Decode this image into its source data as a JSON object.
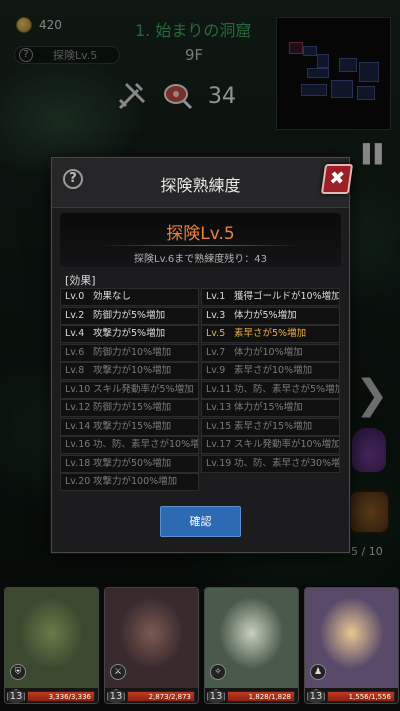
{
  "hud": {
    "gold": "420",
    "explore_badge": "探険Lv.5",
    "floor_name": "1. 始まりの洞窟",
    "floor_number": "9F",
    "meat_count": "34",
    "page_count": "5 / 10"
  },
  "dialog": {
    "title": "探険熟練度",
    "help_glyph": "?",
    "close_glyph": "✖",
    "level_title": "探険Lv.5",
    "level_subtitle": "探険Lv.6まで熟練度残り：43",
    "effects_label": "[効果]",
    "confirm_label": "確認",
    "current_level": 5,
    "effects": [
      {
        "lv": "Lv.0",
        "text": "効果なし"
      },
      {
        "lv": "Lv.1",
        "text": "獲得ゴールドが10%増加"
      },
      {
        "lv": "Lv.2",
        "text": "防御力が5%増加"
      },
      {
        "lv": "Lv.3",
        "text": "体力が5%増加"
      },
      {
        "lv": "Lv.4",
        "text": "攻撃力が5%増加"
      },
      {
        "lv": "Lv.5",
        "text": "素早さが5%増加"
      },
      {
        "lv": "Lv.6",
        "text": "防御力が10%増加"
      },
      {
        "lv": "Lv.7",
        "text": "体力が10%増加"
      },
      {
        "lv": "Lv.8",
        "text": "攻撃力が10%増加"
      },
      {
        "lv": "Lv.9",
        "text": "素早さが10%増加"
      },
      {
        "lv": "Lv.10",
        "text": "スキル発動率が5%増加"
      },
      {
        "lv": "Lv.11",
        "text": "功、防、素早さが5%増加"
      },
      {
        "lv": "Lv.12",
        "text": "防御力が15%増加"
      },
      {
        "lv": "Lv.13",
        "text": "体力が15%増加"
      },
      {
        "lv": "Lv.14",
        "text": "攻撃力が15%増加"
      },
      {
        "lv": "Lv.15",
        "text": "素早さが15%増加"
      },
      {
        "lv": "Lv.16",
        "text": "功、防、素早さが10%増加"
      },
      {
        "lv": "Lv.17",
        "text": "スキル発動率が10%増加"
      },
      {
        "lv": "Lv.18",
        "text": "攻撃力が50%増加"
      },
      {
        "lv": "Lv.19",
        "text": "功、防、素早さが30%増加"
      },
      {
        "lv": "Lv.20",
        "text": "攻撃力が100%増加"
      }
    ]
  },
  "party": [
    {
      "name_icon": "shield-icon",
      "glyph": "⛨",
      "level": "13",
      "hp": "3,336/3,336",
      "hp_fraction": 1.0,
      "colors": [
        "#3b4a2f",
        "#6a7a4a"
      ]
    },
    {
      "name_icon": "sword-icon",
      "glyph": "⚔",
      "level": "13",
      "hp": "2,873/2,873",
      "hp_fraction": 1.0,
      "colors": [
        "#3a2a2e",
        "#7a5a50"
      ]
    },
    {
      "name_icon": "claw-icon",
      "glyph": "✧",
      "level": "13",
      "hp": "1,828/1,828",
      "hp_fraction": 1.0,
      "colors": [
        "#4a5a4a",
        "#c8d0c0"
      ]
    },
    {
      "name_icon": "staff-icon",
      "glyph": "♟",
      "level": "13",
      "hp": "1,556/1,556",
      "hp_fraction": 1.0,
      "colors": [
        "#5a4a6a",
        "#e8c890"
      ]
    }
  ]
}
